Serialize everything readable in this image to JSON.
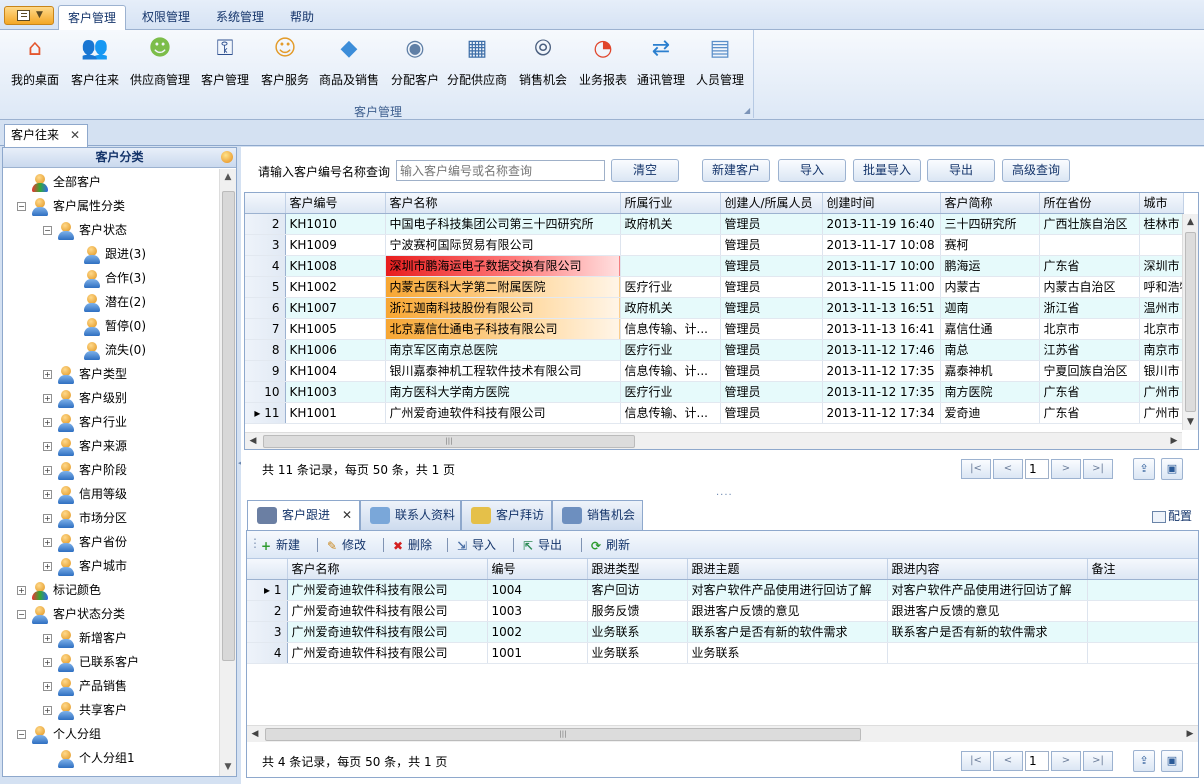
{
  "menu": {
    "tabs": [
      "客户管理",
      "权限管理",
      "系统管理",
      "帮助"
    ]
  },
  "ribbon": {
    "group_label": "客户管理",
    "buttons": [
      {
        "label": "我的桌面",
        "icon": "house-icon",
        "color": "#e4572e"
      },
      {
        "label": "客户往来",
        "icon": "two-people-icon",
        "color": "#3b6fb5"
      },
      {
        "label": "供应商管理",
        "icon": "group-icon",
        "color": "#7cbd4a"
      },
      {
        "label": "客户管理",
        "icon": "people-key-icon",
        "color": "#2d4f8f"
      },
      {
        "label": "客户服务",
        "icon": "person-chat-icon",
        "color": "#e39b2a"
      },
      {
        "label": "商品及销售",
        "icon": "product-cube-icon",
        "color": "#3c8dd9"
      },
      {
        "label": "分配客户",
        "icon": "eye-icon",
        "color": "#5f7fa6"
      },
      {
        "label": "分配供应商",
        "icon": "person-calendar-icon",
        "color": "#3f6fa8"
      },
      {
        "label": "销售机会",
        "icon": "binoculars-icon",
        "color": "#4a5f7f"
      },
      {
        "label": "业务报表",
        "icon": "pie-chart-icon",
        "color": "#e0452b"
      },
      {
        "label": "通讯管理",
        "icon": "sync-arrows-icon",
        "color": "#2b7fcf"
      },
      {
        "label": "人员管理",
        "icon": "id-card-icon",
        "color": "#5b8fc9"
      }
    ]
  },
  "doc_tab": {
    "label": "客户往来",
    "close": "✕"
  },
  "left_panel": {
    "title": "客户分类",
    "tree": [
      {
        "label": "全部客户",
        "level": 0,
        "expander": "",
        "icon": "color"
      },
      {
        "label": "客户属性分类",
        "level": 0,
        "expander": "−",
        "icon": "people"
      },
      {
        "label": "客户状态",
        "level": 1,
        "expander": "−",
        "icon": "person"
      },
      {
        "label": "跟进(3)",
        "level": 2,
        "expander": "",
        "icon": "person"
      },
      {
        "label": "合作(3)",
        "level": 2,
        "expander": "",
        "icon": "person"
      },
      {
        "label": "潜在(2)",
        "level": 2,
        "expander": "",
        "icon": "person"
      },
      {
        "label": "暂停(0)",
        "level": 2,
        "expander": "",
        "icon": "person"
      },
      {
        "label": "流失(0)",
        "level": 2,
        "expander": "",
        "icon": "person"
      },
      {
        "label": "客户类型",
        "level": 1,
        "expander": "+",
        "icon": "person"
      },
      {
        "label": "客户级别",
        "level": 1,
        "expander": "+",
        "icon": "person"
      },
      {
        "label": "客户行业",
        "level": 1,
        "expander": "+",
        "icon": "person"
      },
      {
        "label": "客户来源",
        "level": 1,
        "expander": "+",
        "icon": "person"
      },
      {
        "label": "客户阶段",
        "level": 1,
        "expander": "+",
        "icon": "person"
      },
      {
        "label": "信用等级",
        "level": 1,
        "expander": "+",
        "icon": "person"
      },
      {
        "label": "市场分区",
        "level": 1,
        "expander": "+",
        "icon": "person"
      },
      {
        "label": "客户省份",
        "level": 1,
        "expander": "+",
        "icon": "person"
      },
      {
        "label": "客户城市",
        "level": 1,
        "expander": "+",
        "icon": "person"
      },
      {
        "label": "标记颜色",
        "level": 0,
        "expander": "+",
        "icon": "color"
      },
      {
        "label": "客户状态分类",
        "level": 0,
        "expander": "−",
        "icon": "people"
      },
      {
        "label": "新增客户",
        "level": 1,
        "expander": "+",
        "icon": "person"
      },
      {
        "label": "已联系客户",
        "level": 1,
        "expander": "+",
        "icon": "person"
      },
      {
        "label": "产品销售",
        "level": 1,
        "expander": "+",
        "icon": "person"
      },
      {
        "label": "共享客户",
        "level": 1,
        "expander": "+",
        "icon": "person"
      },
      {
        "label": "个人分组",
        "level": 0,
        "expander": "−",
        "icon": "person"
      },
      {
        "label": "个人分组1",
        "level": 1,
        "expander": "",
        "icon": "person"
      }
    ]
  },
  "search": {
    "label": "请输入客户编号名称查询",
    "placeholder": "输入客户编号或名称查询"
  },
  "toolbar": [
    "清空",
    "新建客户",
    "导入",
    "批量导入",
    "导出",
    "高级查询"
  ],
  "main_grid": {
    "columns": [
      "客户编号",
      "客户名称",
      "所属行业",
      "创建人/所属人员",
      "创建时间",
      "客户简称",
      "所在省份",
      "城市"
    ],
    "rows": [
      {
        "n": "2",
        "cells": [
          "KH1010",
          "中国电子科技集团公司第三十四研究所",
          "政府机关",
          "管理员",
          "2013-11-19 16:40",
          "三十四研究所",
          "广西壮族自治区",
          "桂林市"
        ],
        "hl": ""
      },
      {
        "n": "3",
        "cells": [
          "KH1009",
          "宁波赛柯国际贸易有限公司",
          "",
          "管理员",
          "2013-11-17 10:08",
          "赛柯",
          "",
          ""
        ],
        "hl": ""
      },
      {
        "n": "4",
        "cells": [
          "KH1008",
          "深圳市鹏海运电子数据交换有限公司",
          "",
          "管理员",
          "2013-11-17 10:00",
          "鹏海运",
          "广东省",
          "深圳市"
        ],
        "hl": "red"
      },
      {
        "n": "5",
        "cells": [
          "KH1002",
          "内蒙古医科大学第二附属医院",
          "医疗行业",
          "管理员",
          "2013-11-15 11:00",
          "内蒙古",
          "内蒙古自治区",
          "呼和浩特"
        ],
        "hl": "orange"
      },
      {
        "n": "6",
        "cells": [
          "KH1007",
          "浙江迦南科技股份有限公司",
          "政府机关",
          "管理员",
          "2013-11-13 16:51",
          "迦南",
          "浙江省",
          "温州市"
        ],
        "hl": "orange"
      },
      {
        "n": "7",
        "cells": [
          "KH1005",
          "北京嘉信仕通电子科技有限公司",
          "信息传输、计...",
          "管理员",
          "2013-11-13 16:41",
          "嘉信仕通",
          "北京市",
          "北京市"
        ],
        "hl": "orange"
      },
      {
        "n": "8",
        "cells": [
          "KH1006",
          "南京军区南京总医院",
          "医疗行业",
          "管理员",
          "2013-11-12 17:46",
          "南总",
          "江苏省",
          "南京市"
        ],
        "hl": ""
      },
      {
        "n": "9",
        "cells": [
          "KH1004",
          "银川嘉泰神机工程软件技术有限公司",
          "信息传输、计...",
          "管理员",
          "2013-11-12 17:35",
          "嘉泰神机",
          "宁夏回族自治区",
          "银川市"
        ],
        "hl": ""
      },
      {
        "n": "10",
        "cells": [
          "KH1003",
          "南方医科大学南方医院",
          "医疗行业",
          "管理员",
          "2013-11-12 17:35",
          "南方医院",
          "广东省",
          "广州市"
        ],
        "hl": ""
      },
      {
        "n": "11",
        "cells": [
          "KH1001",
          "广州爱奇迪软件科技有限公司",
          "信息传输、计...",
          "管理员",
          "2013-11-12 17:34",
          "爱奇迪",
          "广东省",
          "广州市"
        ],
        "hl": "",
        "current": true
      }
    ],
    "footer": "共 11 条记录，每页 50 条，共 1 页",
    "page": "1"
  },
  "pager_buttons": [
    "|<",
    "<",
    ">",
    ">|"
  ],
  "bottom_tabs": [
    {
      "label": "客户跟进",
      "active": true,
      "close": "✕",
      "color": "#6b7fa3"
    },
    {
      "label": "联系人资料",
      "active": false,
      "close": "",
      "color": "#7aa7d9"
    },
    {
      "label": "客户拜访",
      "active": false,
      "close": "",
      "color": "#e5c049"
    },
    {
      "label": "销售机会",
      "active": false,
      "close": "",
      "color": "#6d8fbf"
    }
  ],
  "config_label": "配置",
  "bottom_toolbar": [
    {
      "label": "新建",
      "icon": "plus-icon",
      "glyph": "+",
      "color": "#2e9b2e"
    },
    {
      "label": "修改",
      "icon": "pencil-icon",
      "glyph": "✎",
      "color": "#c9861c"
    },
    {
      "label": "删除",
      "icon": "delete-x-icon",
      "glyph": "✖",
      "color": "#d42020"
    },
    {
      "label": "导入",
      "icon": "import-icon",
      "glyph": "⇲",
      "color": "#4a6fa5"
    },
    {
      "label": "导出",
      "icon": "export-icon",
      "glyph": "⇱",
      "color": "#2e8b57"
    },
    {
      "label": "刷新",
      "icon": "refresh-icon",
      "glyph": "⟳",
      "color": "#2e9b2e"
    }
  ],
  "detail_grid": {
    "columns": [
      "客户名称",
      "编号",
      "跟进类型",
      "跟进主题",
      "跟进内容",
      "备注"
    ],
    "rows": [
      {
        "n": "1",
        "cells": [
          "广州爱奇迪软件科技有限公司",
          "1004",
          "客户回访",
          "对客户软件产品使用进行回访了解",
          "对客户软件产品使用进行回访了解",
          ""
        ],
        "current": true
      },
      {
        "n": "2",
        "cells": [
          "广州爱奇迪软件科技有限公司",
          "1003",
          "服务反馈",
          "跟进客户反馈的意见",
          "跟进客户反馈的意见",
          ""
        ]
      },
      {
        "n": "3",
        "cells": [
          "广州爱奇迪软件科技有限公司",
          "1002",
          "业务联系",
          "联系客户是否有新的软件需求",
          "联系客户是否有新的软件需求",
          ""
        ]
      },
      {
        "n": "4",
        "cells": [
          "广州爱奇迪软件科技有限公司",
          "1001",
          "业务联系",
          "业务联系",
          "",
          ""
        ]
      }
    ],
    "footer": "共 4 条记录，每页 50 条，共 1 页",
    "page": "1"
  }
}
